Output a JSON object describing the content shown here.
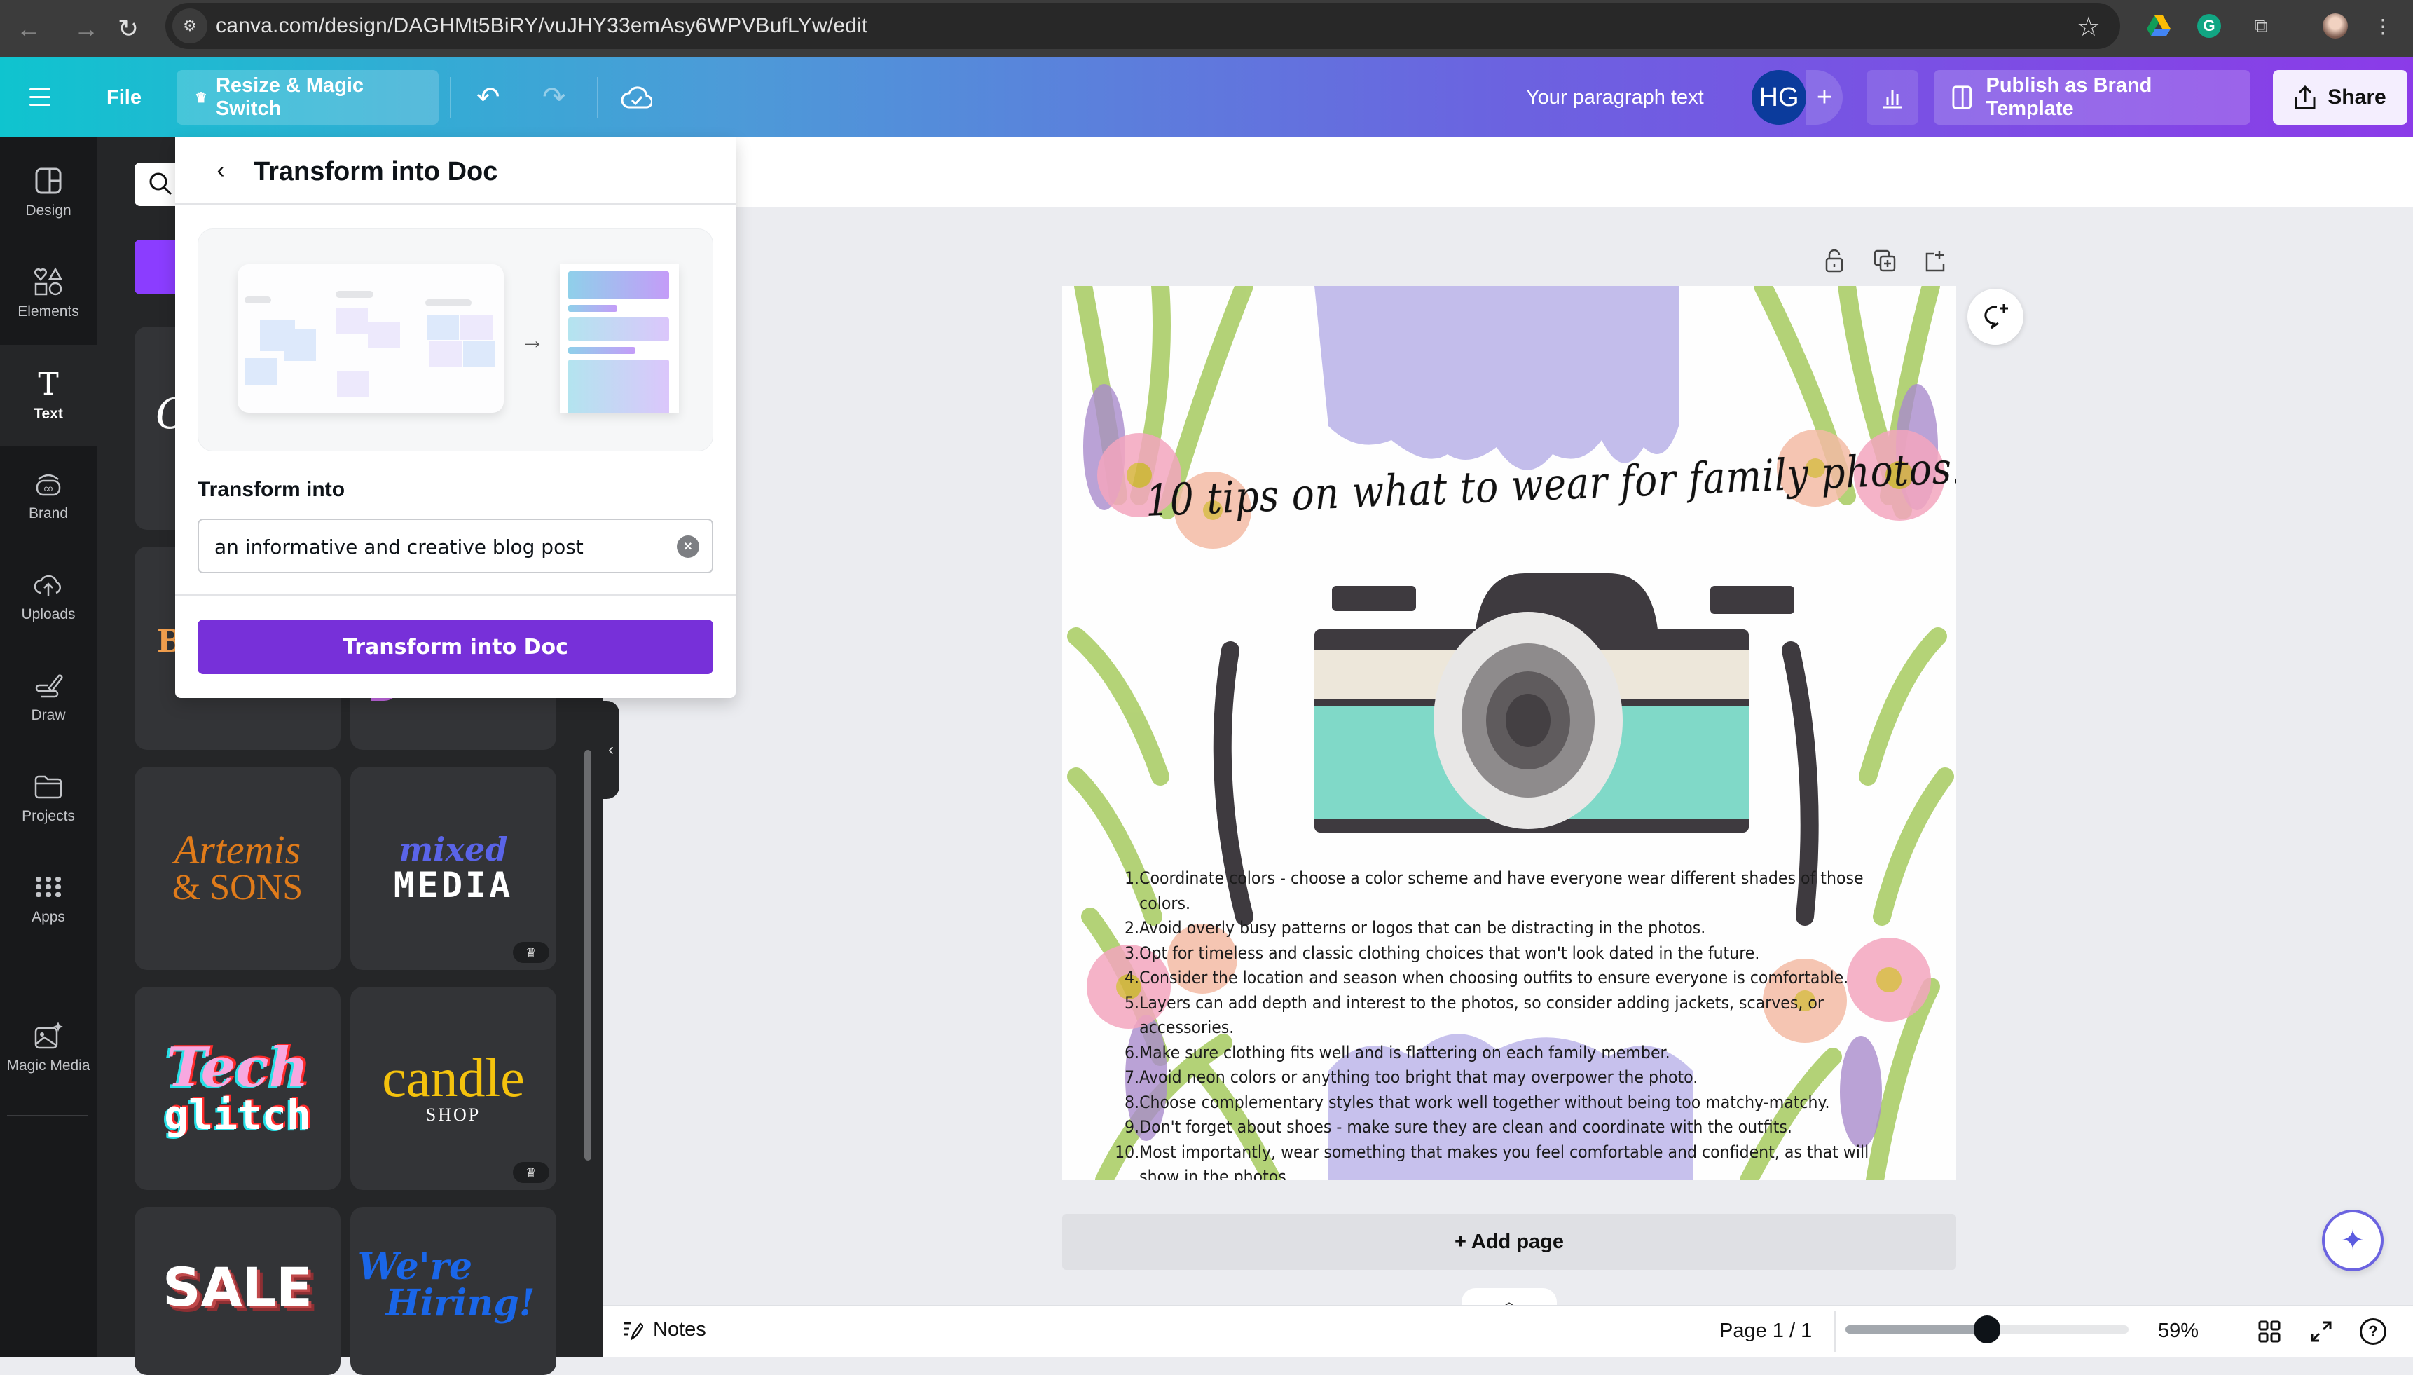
{
  "browser": {
    "url": "canva.com/design/DAGHMt5BiRY/vuJHY33emAsy6WPVBufLYw/edit",
    "nav_icons": [
      "back-arrow-icon",
      "forward-arrow-icon",
      "reload-icon"
    ],
    "extension_icons": [
      "google-drive-icon",
      "grammarly-icon",
      "extensions-puzzle-icon",
      "profile-avatar-icon",
      "more-menu-icon"
    ]
  },
  "topbar": {
    "menu_icon": "hamburger-icon",
    "file_label": "File",
    "resize_label": "Resize & Magic Switch",
    "undo_icon": "undo-icon",
    "redo_icon": "redo-icon",
    "save_status_icon": "cloud-check-icon",
    "design_name": "Your paragraph text",
    "avatar_initials": "HG",
    "add_collaborator": "+",
    "insights_icon": "bar-chart-icon",
    "publish_label": "Publish as Brand Template",
    "share_label": "Share"
  },
  "rail": {
    "items": [
      {
        "label": "Design",
        "icon": "design-layout-icon"
      },
      {
        "label": "Elements",
        "icon": "shapes-icon"
      },
      {
        "label": "Text",
        "icon": "text-t-icon",
        "active": true
      },
      {
        "label": "Brand",
        "icon": "brand-icon"
      },
      {
        "label": "Uploads",
        "icon": "cloud-upload-icon"
      },
      {
        "label": "Draw",
        "icon": "draw-pen-icon"
      },
      {
        "label": "Projects",
        "icon": "folder-icon"
      },
      {
        "label": "Apps",
        "icon": "apps-grid-icon"
      },
      {
        "label": "Magic Media",
        "icon": "magic-media-icon"
      }
    ]
  },
  "text_panel": {
    "cards": [
      {
        "line1": "Artemis",
        "line2": "& SONS",
        "premium": false
      },
      {
        "line1": "mixed",
        "line2": "MEDIA",
        "premium": true
      },
      {
        "line1": "Tech",
        "line2": "glitch",
        "premium": false
      },
      {
        "line1": "candle",
        "line2": "SHOP",
        "premium": true
      },
      {
        "line1": "SALE",
        "line2": "",
        "premium": false
      },
      {
        "line1": "We're",
        "line2": "Hiring!",
        "premium": false
      }
    ],
    "partial_card_left": "B",
    "collapse_icon": "chevron-left-icon"
  },
  "modal": {
    "title": "Transform into Doc",
    "back_icon": "chevron-left-icon",
    "field_label": "Transform into",
    "field_value": "an informative and creative blog post",
    "clear_icon": "clear-x-icon",
    "submit_label": "Transform into Doc"
  },
  "canvas": {
    "page_tools": [
      "lock-icon",
      "duplicate-page-icon",
      "add-page-icon"
    ],
    "comment_icon": "add-comment-icon",
    "design": {
      "title": "10 tips on what to wear for family photos:",
      "tips": [
        "Coordinate colors - choose a color scheme and have everyone wear different shades of those colors.",
        "Avoid overly busy patterns or logos that can be distracting in the photos.",
        "Opt for timeless and classic clothing choices that won't look dated in the future.",
        "Consider the location and season when choosing outfits to ensure everyone is comfortable.",
        "Layers can add depth and interest to the photos, so consider adding jackets, scarves, or accessories.",
        "Make sure clothing fits well and is flattering on each family member.",
        "Avoid neon colors or anything too bright that may overpower the photo.",
        "Choose complementary styles that work well together without being too matchy-matchy.",
        "Don't forget about shoes - make sure they are clean and coordinate with the outfits.",
        "Most importantly, wear something that makes you feel comfortable and confident, as that will show in the photos."
      ]
    },
    "add_page_label": "+ Add page",
    "magic_icon": "sparkle-icon"
  },
  "bottombar": {
    "notes_label": "Notes",
    "page_label": "Page 1 / 1",
    "zoom_percent": 59,
    "zoom_label": "59%",
    "zoom_slider_fraction": 0.5,
    "icons": [
      "grid-view-icon",
      "fullscreen-icon",
      "help-icon"
    ]
  },
  "colors": {
    "accent_purple": "#7730d9",
    "brand_purple": "#8b3dff",
    "gradient_start": "#0fc4cf",
    "gradient_end": "#8b3be8"
  }
}
